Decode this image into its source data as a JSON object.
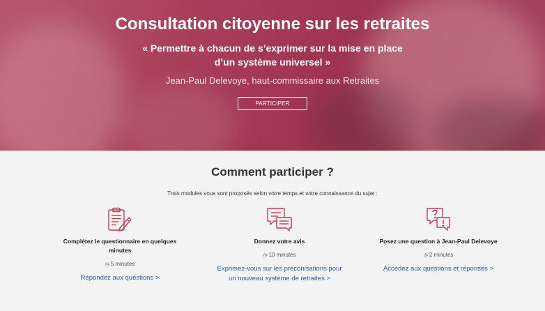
{
  "hero": {
    "title": "Consultation citoyenne sur les retraites",
    "quote_line1": "« Permettre à chacun de s’exprimer sur la mise en place",
    "quote_line2": "d’un système universel »",
    "author": "Jean-Paul Delevoye, haut-commissaire aux Retraites",
    "button": "PARTICIPER"
  },
  "section": {
    "title": "Comment participer ?",
    "intro": "Trois modules vous sont proposés selon votre temps et votre connaissance du sujet :"
  },
  "modules": [
    {
      "icon": "clipboard-pen-icon",
      "title": "Complétez le questionnaire en quelques minutes",
      "time": "5 minutes",
      "link_line1": "Répondez aux questions >",
      "link_line2": ""
    },
    {
      "icon": "chat-bubbles-icon",
      "title": "Donnez votre avis",
      "time": "10 minutes",
      "link_line1": "Exprimez-vous sur les préconisations pour",
      "link_line2": "un nouveau système de retraites >"
    },
    {
      "icon": "question-bubble-icon",
      "title": "Posez une question à Jean-Paul Delevoye",
      "time": "2 minutes",
      "link_line1": "Accédez aux questions et réponses >",
      "link_line2": ""
    }
  ],
  "colors": {
    "hero": "#a83e58",
    "icon": "#c63a55",
    "link": "#2f5b9c",
    "background": "#f3f3f3"
  }
}
